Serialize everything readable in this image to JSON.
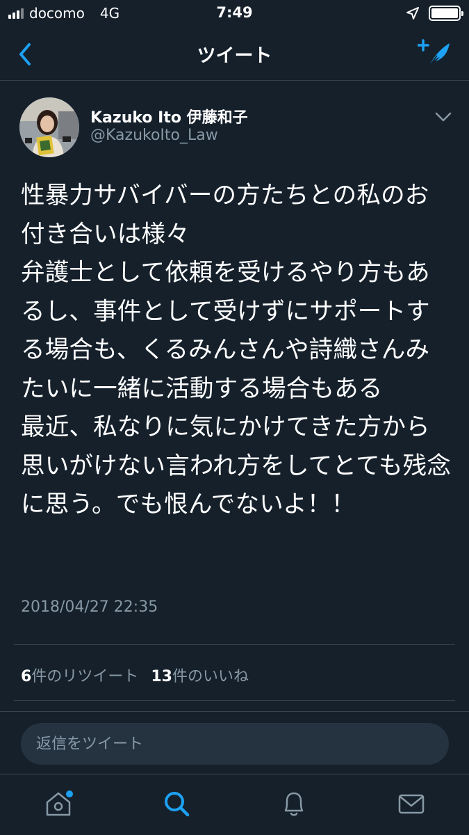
{
  "status_bar": {
    "carrier": "docomo",
    "network": "4G",
    "time": "7:49"
  },
  "nav": {
    "title": "ツイート",
    "back_icon": "chevron-left-icon",
    "compose_icon": "compose-tweet-icon"
  },
  "tweet": {
    "user_name": "Kazuko Ito 伊藤和子",
    "user_handle": "@KazukoIto_Law",
    "text": "性暴力サバイバーの方たちとの私のお付き合いは様々\n弁護士として依頼を受けるやり方もあるし、事件として受けずにサポートする場合も、くるみんさんや詩織さんみたいに一緒に活動する場合もある\n最近、私なりに気にかけてきた方から思いがけない言われ方をしてとても残念に思う。でも恨んでないよ！！",
    "timestamp": "2018/04/27 22:35",
    "retweets_count": "6",
    "retweets_label": "件のリツイート",
    "likes_count": "13",
    "likes_label": "件のいいね"
  },
  "reply": {
    "placeholder": "返信をツイート"
  },
  "tab_bar": {
    "items": [
      "home-icon",
      "search-icon",
      "notifications-icon",
      "messages-icon"
    ],
    "active": "search-icon"
  },
  "colors": {
    "background": "#15202b",
    "accent": "#1da1f2",
    "secondary_text": "#8899a6",
    "divider": "#38444d"
  }
}
